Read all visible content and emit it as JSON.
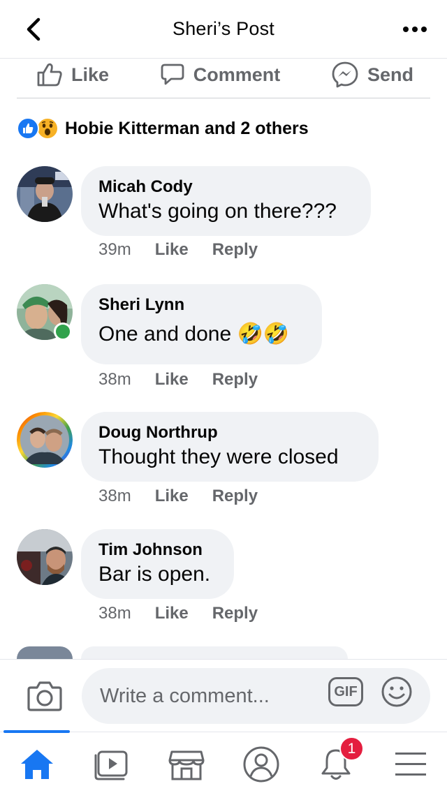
{
  "header": {
    "title": "Sheri’s Post",
    "back_icon": "chevron-left-icon",
    "more_icon": "more-dots-icon"
  },
  "actions": {
    "like": "Like",
    "comment": "Comment",
    "send": "Send"
  },
  "reactions": {
    "summary": "Hobie Kitterman and 2 others",
    "types": [
      "like",
      "wow"
    ]
  },
  "comments": [
    {
      "name": "Micah Cody",
      "text": "What's going on there???",
      "time": "39m",
      "like": "Like",
      "reply": "Reply",
      "online": false
    },
    {
      "name": "Sheri Lynn",
      "text": "One and done 🤣🤣",
      "time": "38m",
      "like": "Like",
      "reply": "Reply",
      "online": true
    },
    {
      "name": "Doug Northrup",
      "text": "Thought they were closed",
      "time": "38m",
      "like": "Like",
      "reply": "Reply",
      "online": false
    },
    {
      "name": "Tim Johnson",
      "text": "Bar is open.",
      "time": "38m",
      "like": "Like",
      "reply": "Reply",
      "online": false
    }
  ],
  "composer": {
    "placeholder": "Write a comment...",
    "gif_label": "GIF"
  },
  "tabbar": {
    "items": [
      "home-icon",
      "watch-icon",
      "marketplace-icon",
      "profile-icon",
      "notifications-icon",
      "menu-icon"
    ],
    "active": "home-icon",
    "notification_count": "1"
  },
  "colors": {
    "accent": "#1877f2",
    "bubble": "#f0f2f5",
    "secondary_text": "#65676b",
    "badge": "#e41e3f",
    "online": "#31a24c"
  }
}
